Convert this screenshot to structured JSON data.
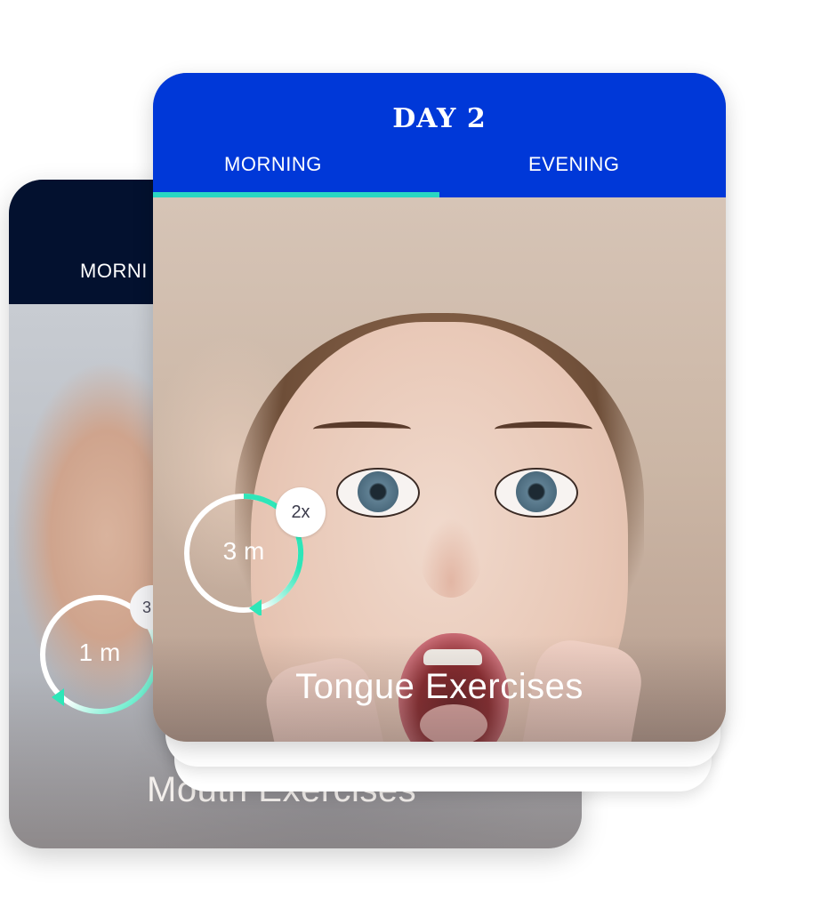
{
  "back_card": {
    "tab_morning": "MORNI",
    "timer_label": "1 m",
    "repeat_badge": "3",
    "title": "Mouth Exercises",
    "header_color": "#03112f"
  },
  "front_card": {
    "day_title": "DAY 2",
    "tabs": [
      {
        "label": "MORNING",
        "selected": true
      },
      {
        "label": "EVENING",
        "selected": false
      }
    ],
    "timer_label": "3 m",
    "repeat_badge": "2x",
    "title": "Tongue Exercises",
    "header_color": "#0038d8",
    "accent_color": "#2ad6c2"
  },
  "icons": {
    "timer_ring": "circular-arrow-icon"
  }
}
